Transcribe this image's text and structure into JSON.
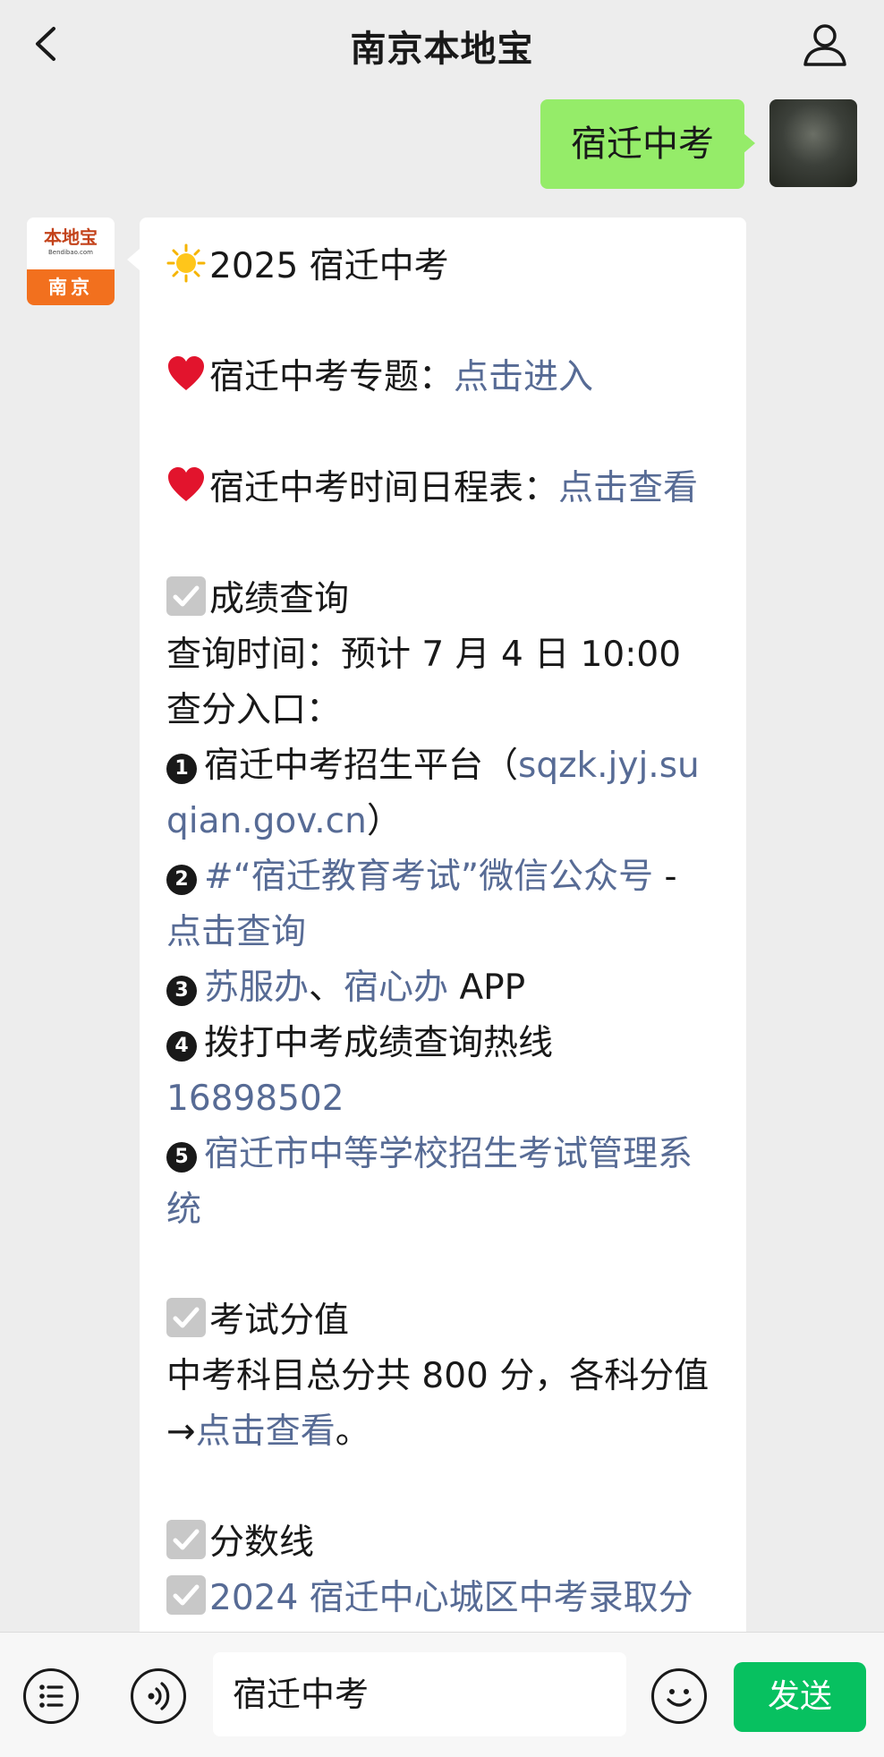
{
  "header": {
    "title": "南京本地宝",
    "back_icon": "chevron-left-icon",
    "profile_icon": "person-icon"
  },
  "messages": {
    "outgoing": {
      "text": "宿迁中考",
      "bubble_color": "#95ec69"
    },
    "incoming": {
      "avatar": {
        "logo_text": "本地宝",
        "logo_url": "Bendibao.com",
        "city": "南京"
      },
      "lines": {
        "title": "2025 宿迁中考",
        "topic_label": "宿迁中考专题：",
        "topic_link": "点击进入",
        "schedule_label": "宿迁中考时间日程表：",
        "schedule_link": "点击查看",
        "score_heading": "成绩查询",
        "query_time": "查询时间：预计 7 月 4 日 10:00",
        "query_entry": "查分入口：",
        "item1_text": "宿迁中考招生平台（",
        "item1_link": "sqzk.jyj.suqian.gov.cn",
        "item1_end": "）",
        "item2_link": "#“宿迁教育考试”微信公众号",
        "item2_dash": " - ",
        "item2_link2": "点击查询",
        "item3_link1": "苏服办",
        "item3_sep": "、",
        "item3_link2": "宿心办",
        "item3_end": " APP",
        "item4_text": "拨打中考成绩查询热线",
        "item4_link": "16898502",
        "item5_link": "宿迁市中等学校招生考试管理系统",
        "value_heading": "考试分值",
        "value_text": "中考科目总分共 800 分，各科分值→",
        "value_link": "点击查看",
        "value_end": "。",
        "cutoff_heading": "分数线",
        "cutoff_partial": "2024 宿迁中心城区中考录取分"
      },
      "link_color": "#576b95"
    }
  },
  "composer": {
    "input_value": "宿迁中考",
    "send_label": "发送",
    "menu_icon": "list-icon",
    "voice_icon": "voice-icon",
    "emoji_icon": "emoji-icon",
    "send_color": "#07c160"
  }
}
